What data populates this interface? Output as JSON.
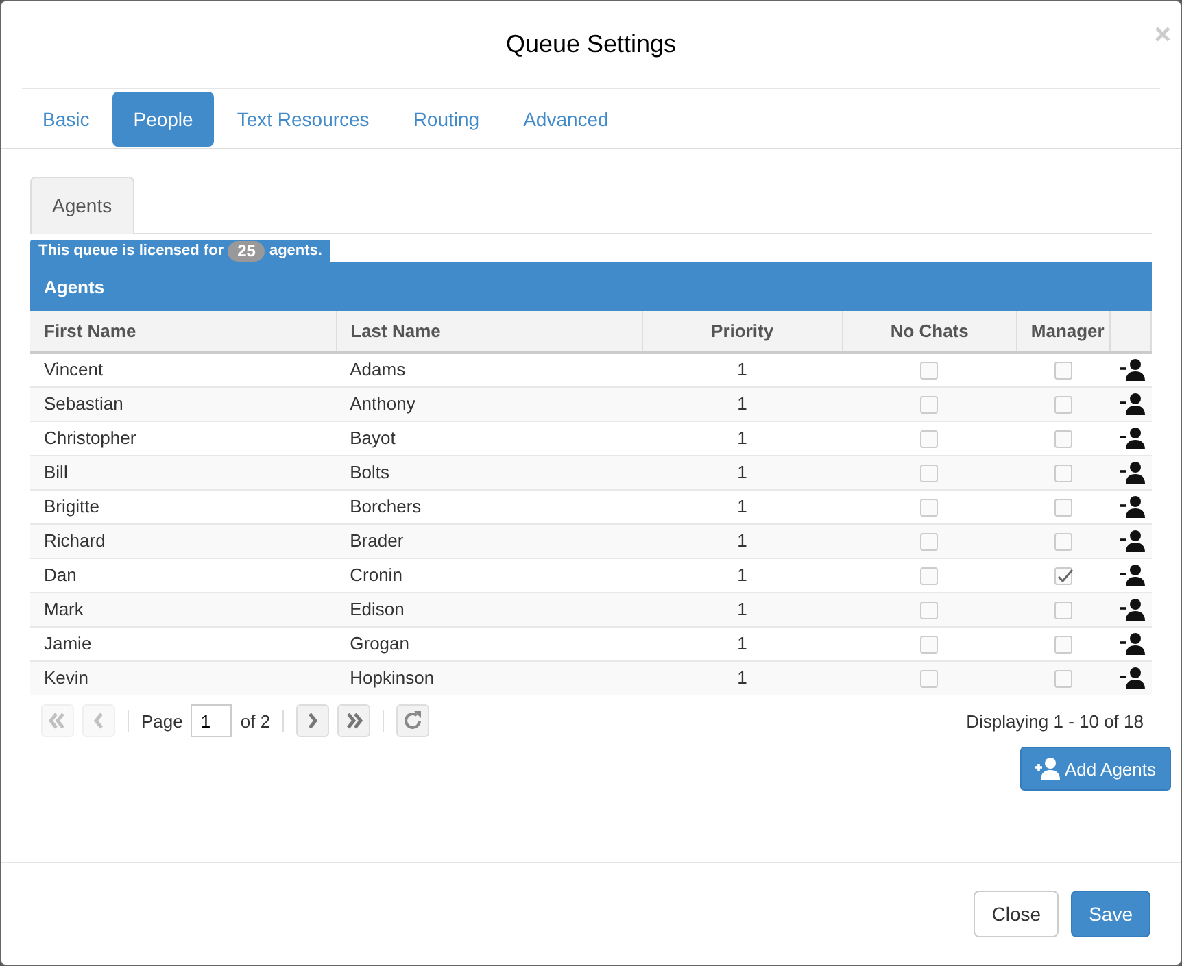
{
  "window": {
    "title": "Queue Settings",
    "close": "×"
  },
  "tabs": [
    {
      "label": "Basic",
      "selected": false
    },
    {
      "label": "People",
      "selected": true
    },
    {
      "label": "Text Resources",
      "selected": false
    },
    {
      "label": "Routing",
      "selected": false
    },
    {
      "label": "Advanced",
      "selected": false
    }
  ],
  "subtabs": [
    {
      "label": "Agents",
      "selected": true
    }
  ],
  "license": {
    "before": "This queue is licensed for",
    "count": "25",
    "after": "agents."
  },
  "table": {
    "title": "Agents",
    "columns": [
      "First Name",
      "Last Name",
      "Priority",
      "No Chats",
      "Manager"
    ],
    "rows": [
      {
        "first": "Vincent",
        "last": "Adams",
        "priority": "1",
        "no_chats": false,
        "manager": false
      },
      {
        "first": "Sebastian",
        "last": "Anthony",
        "priority": "1",
        "no_chats": false,
        "manager": false
      },
      {
        "first": "Christopher",
        "last": "Bayot",
        "priority": "1",
        "no_chats": false,
        "manager": false
      },
      {
        "first": "Bill",
        "last": "Bolts",
        "priority": "1",
        "no_chats": false,
        "manager": false
      },
      {
        "first": "Brigitte",
        "last": "Borchers",
        "priority": "1",
        "no_chats": false,
        "manager": false
      },
      {
        "first": "Richard",
        "last": "Brader",
        "priority": "1",
        "no_chats": false,
        "manager": false
      },
      {
        "first": "Dan",
        "last": "Cronin",
        "priority": "1",
        "no_chats": false,
        "manager": true
      },
      {
        "first": "Mark",
        "last": "Edison",
        "priority": "1",
        "no_chats": false,
        "manager": false
      },
      {
        "first": "Jamie",
        "last": "Grogan",
        "priority": "1",
        "no_chats": false,
        "manager": false
      },
      {
        "first": "Kevin",
        "last": "Hopkinson",
        "priority": "1",
        "no_chats": false,
        "manager": false
      }
    ]
  },
  "pager": {
    "first_disabled": true,
    "prev_disabled": true,
    "next_disabled": false,
    "last_disabled": false,
    "page_label": "Page",
    "page": "1",
    "of": "of 2",
    "display": "Displaying 1 - 10 of 18"
  },
  "add_button": "Add Agents",
  "footer_buttons": [
    {
      "label": "Close",
      "kind": "default"
    },
    {
      "label": "Save",
      "kind": "primary"
    }
  ]
}
